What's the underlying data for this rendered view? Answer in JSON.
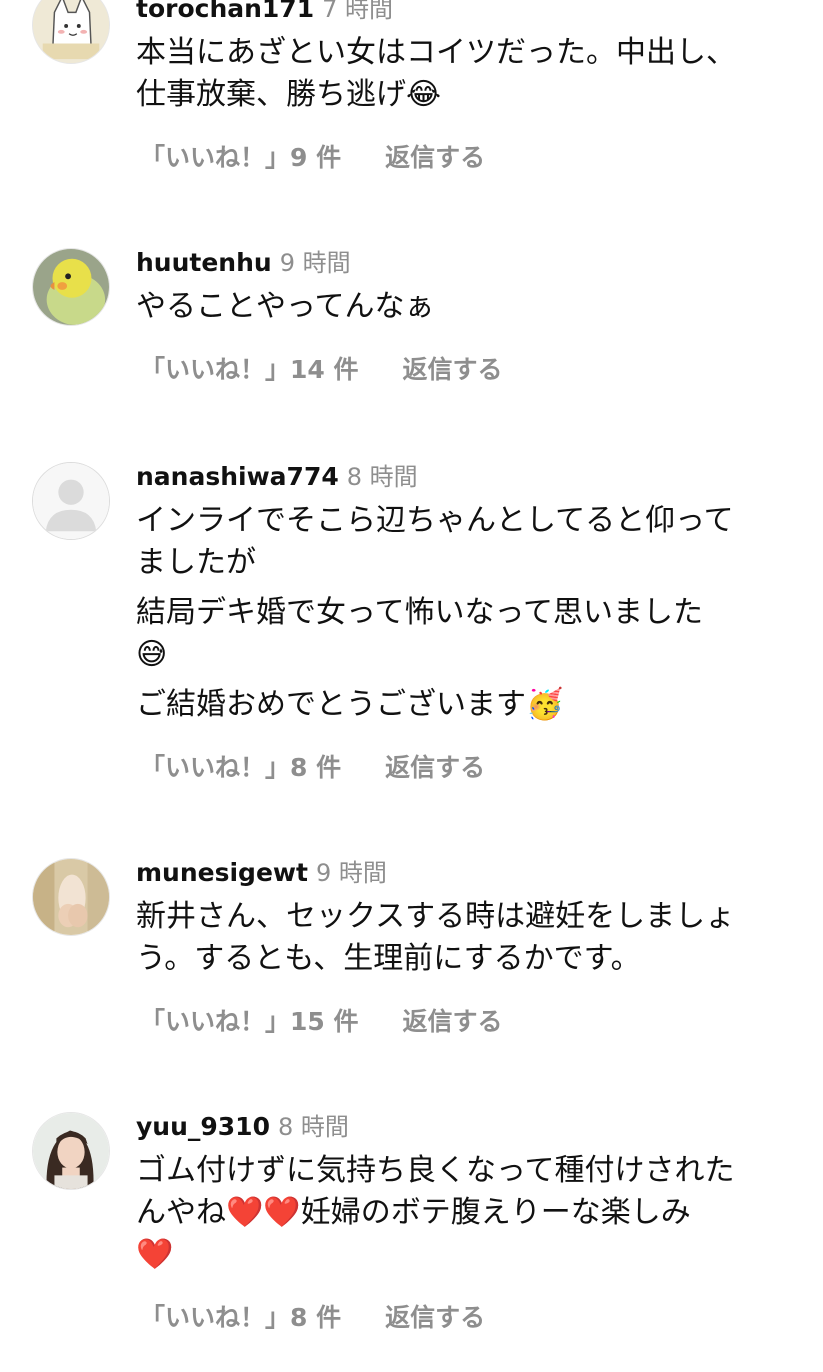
{
  "comments": [
    {
      "username": "torochan171",
      "time": "7 時間",
      "lines": [
        "本当にあざとい女はコイツだった。中出し、",
        "仕事放棄、勝ち逃げ😂"
      ],
      "likes": "「いいね！」9 件",
      "reply": "返信する",
      "avatar": "cat-drawing-avatar"
    },
    {
      "username": "huutenhu",
      "time": "9 時間",
      "lines": [
        "やることやってんなぁ"
      ],
      "likes": "「いいね！」14 件",
      "reply": "返信する",
      "avatar": "bird-avatar"
    },
    {
      "username": "nanashiwa774",
      "time": "8 時間",
      "lines": [
        "インライでそこら辺ちゃんとしてると仰って",
        "ましたが"
      ],
      "lines2": [
        "結局デキ婚で女って怖いなって思いました",
        "😅"
      ],
      "lines3": [
        "ご結婚おめでとうございます🥳"
      ],
      "likes": "「いいね！」8 件",
      "reply": "返信する",
      "avatar": "default-user-avatar"
    },
    {
      "username": "munesigewt",
      "time": "9 時間",
      "lines": [
        "新井さん、セックスする時は避妊をしましょ",
        "う。するとも、生理前にするかです。"
      ],
      "likes": "「いいね！」15 件",
      "reply": "返信する",
      "avatar": "figure-avatar"
    },
    {
      "username": "yuu_9310",
      "time": "8 時間",
      "lines": [
        "ゴム付けずに気持ち良くなって種付けされた",
        "んやね❤️❤️妊婦のボテ腹えりーな楽しみ",
        "❤️"
      ],
      "likes": "「いいね！」8 件",
      "reply": "返信する",
      "avatar": "woman-photo-avatar"
    }
  ]
}
